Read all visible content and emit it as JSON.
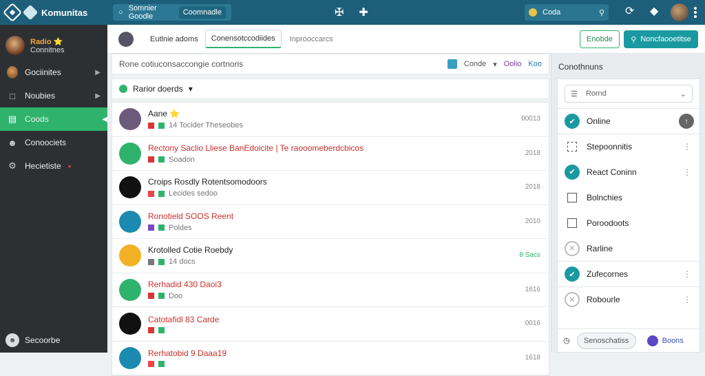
{
  "app": {
    "title": "Komunitas"
  },
  "topbar": {
    "search_tab": "Somnier Goodle",
    "search_tab2": "Coomnadle",
    "right_search": "Coda"
  },
  "sidebar": {
    "user_name": "Radio ⭐",
    "user_sub": "Connitnes",
    "items": [
      {
        "label": "Gociinites",
        "icon": "avatar-icon"
      },
      {
        "label": "Noubies",
        "icon": "chat-icon"
      },
      {
        "label": "Coods",
        "icon": "monitor-icon"
      },
      {
        "label": "Conoociets",
        "icon": "user-icon"
      },
      {
        "label": "Hecietiste",
        "icon": "settings-icon"
      }
    ],
    "bottom": "Secoorbe"
  },
  "subbar": {
    "tab1": "Eutlnie adoms",
    "tab2": "Conensotccodiides",
    "tab3": "Inprooccarcs",
    "btn_outline": "Enobde",
    "btn_primary": "Noncfaooetitse"
  },
  "filter": {
    "text": "Rone cotiuconsaccongie cortnoris",
    "mid": "Conde",
    "right1": "Oolio",
    "right2": "Koo"
  },
  "status": {
    "label": "Rarior doerds"
  },
  "rows": [
    {
      "title": "Aane ⭐",
      "meta": "14  Tocider Theseobes",
      "time": "00013",
      "color": "#6b5a7a"
    },
    {
      "title": "Rectony Saclio Lliese BanEdoicite | Te raooomeberdcbicos",
      "meta": "Soadon",
      "time": "2018",
      "color": "#2fb36c",
      "red": true
    },
    {
      "title": "Croips Rosdly Rotentsomodoors",
      "meta": "Lecides sedoo",
      "time": "2018",
      "color": "#111"
    },
    {
      "title": "Ronotield SOOS Reent",
      "meta": "Poldes",
      "time": "2010",
      "color": "#1c8ab0",
      "red": true
    },
    {
      "title": "Krotolled Cotie Roebdy",
      "meta": "14 docs",
      "time": "8 Sacs",
      "color": "#f2b024",
      "green": true
    },
    {
      "title": "Rerhadid 430  Daoi3",
      "meta": "Doo",
      "time": "1616",
      "color": "#2fb36c",
      "red": true
    },
    {
      "title": "Catotafidl 83  Carde",
      "meta": "",
      "time": "0016",
      "color": "#111",
      "red": true
    },
    {
      "title": "Rerhatobid 9  Daaa19",
      "meta": "",
      "time": "1618",
      "color": "#1c8ab0",
      "red": true
    }
  ],
  "rpanel": {
    "title": "Conothnuns",
    "select": "Rornd",
    "items": [
      {
        "label": "Online",
        "style": "teal",
        "glyph": "✔",
        "extra": "pill"
      },
      {
        "label": "Stepoonnitis",
        "style": "dashed",
        "extra": "kebab"
      },
      {
        "label": "React Coninn",
        "style": "teal",
        "glyph": "✔",
        "extra": "kebab"
      },
      {
        "label": "Bolnchies",
        "style": "box"
      },
      {
        "label": "Poroodoots",
        "style": "box"
      },
      {
        "label": "Rarline",
        "style": "grey"
      },
      {
        "label": "Zufecornes",
        "style": "teal",
        "glyph": "✔",
        "extra": "kebab"
      },
      {
        "label": "Robourle",
        "style": "grey",
        "extra": "kebab"
      }
    ],
    "footer_btn": "Senoschatiss",
    "footer_link": "Boons"
  }
}
